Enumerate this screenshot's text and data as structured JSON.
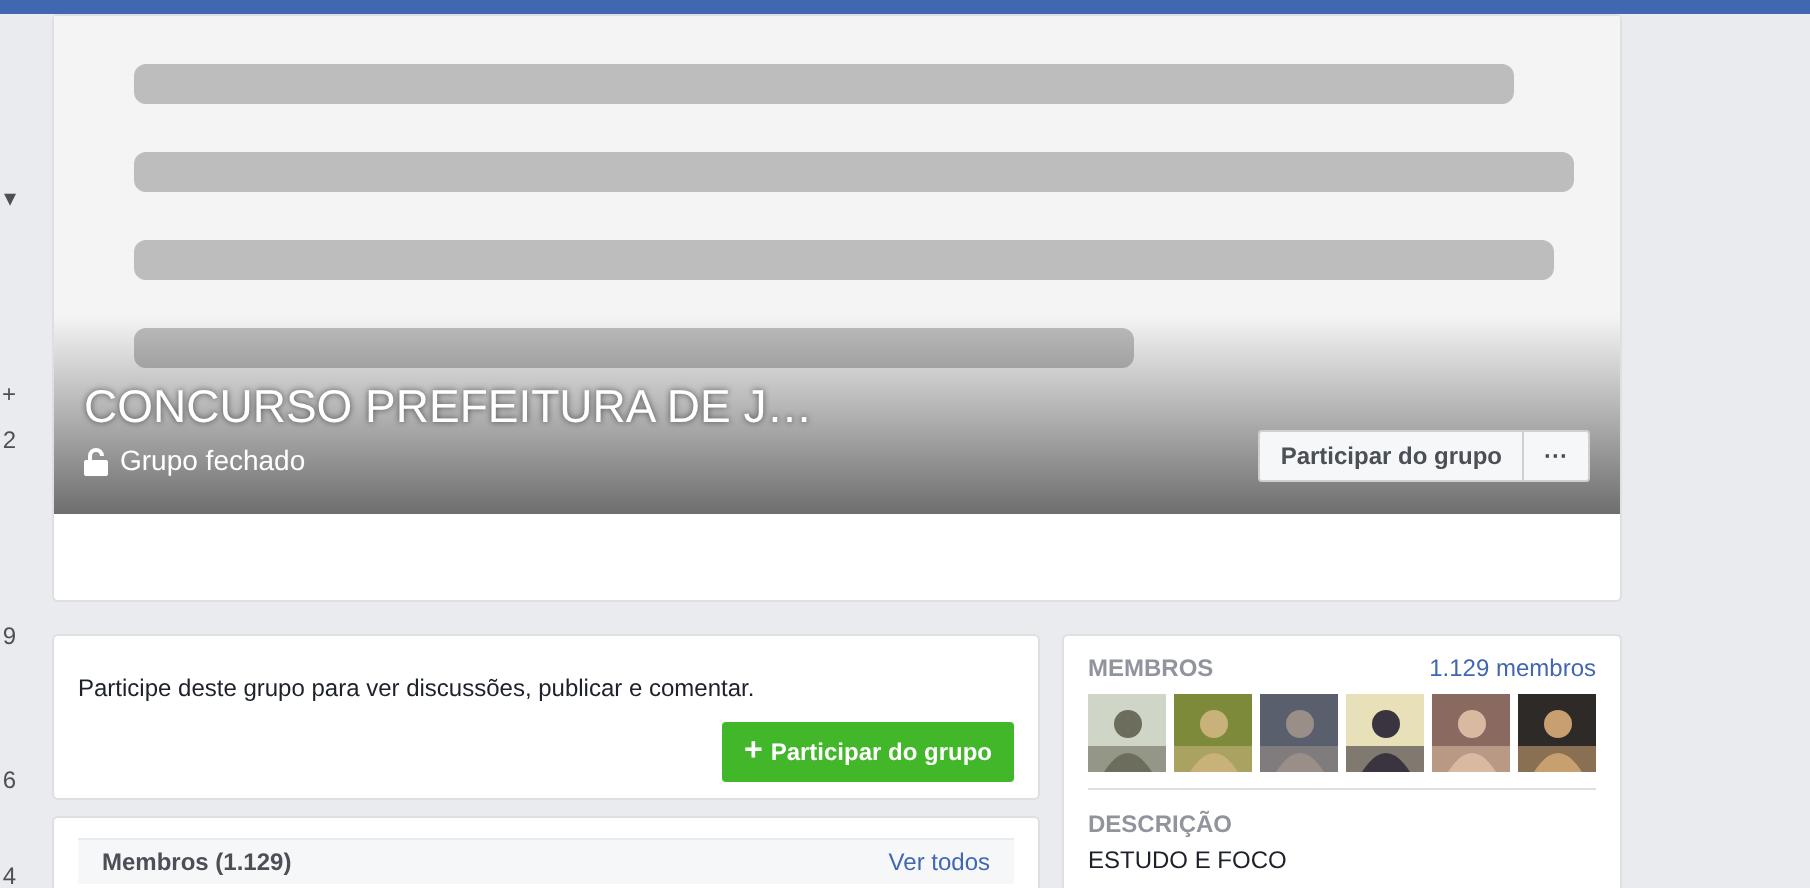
{
  "left_edge": [
    "▾",
    "+",
    "2",
    "9",
    "6",
    "4"
  ],
  "group": {
    "title": "CONCURSO PREFEITURA DE J…",
    "privacy": "Grupo fechado",
    "join_button": "Participar do grupo",
    "more_button": "···"
  },
  "join_prompt": {
    "text": "Participe deste grupo para ver discussões, publicar e comentar.",
    "button_icon": "+",
    "button": "Participar do grupo"
  },
  "members_panel": {
    "title": "Membros (1.129)",
    "link": "Ver todos"
  },
  "sidebar": {
    "members_title": "MEMBROS",
    "members_count": "1.129 membros",
    "description_title": "DESCRIÇÃO",
    "description": "ESTUDO E FOCO"
  }
}
